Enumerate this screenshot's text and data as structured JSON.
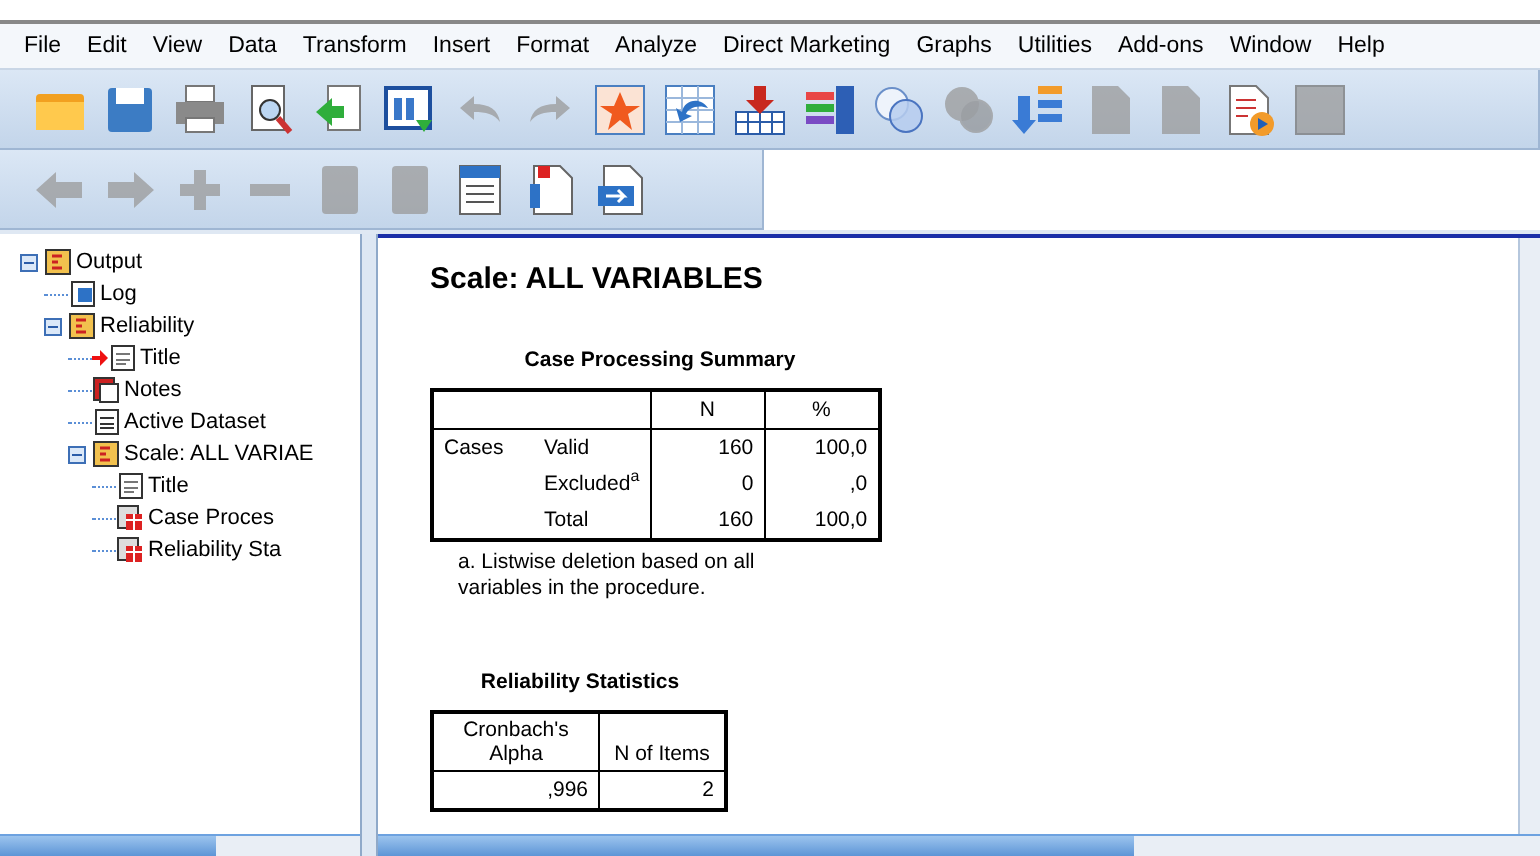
{
  "menu": [
    "File",
    "Edit",
    "View",
    "Data",
    "Transform",
    "Insert",
    "Format",
    "Analyze",
    "Direct Marketing",
    "Graphs",
    "Utilities",
    "Add-ons",
    "Window",
    "Help"
  ],
  "toolbar_main": [
    {
      "kind": "folder",
      "disabled": false
    },
    {
      "kind": "save",
      "disabled": false
    },
    {
      "kind": "print",
      "disabled": false
    },
    {
      "kind": "preview",
      "disabled": false
    },
    {
      "kind": "export",
      "disabled": false
    },
    {
      "kind": "dialog",
      "disabled": false
    },
    {
      "kind": "undo",
      "disabled": true
    },
    {
      "kind": "redo",
      "disabled": true
    },
    {
      "kind": "star",
      "disabled": false
    },
    {
      "kind": "gridarrow",
      "disabled": false
    },
    {
      "kind": "download",
      "disabled": false
    },
    {
      "kind": "bars",
      "disabled": false
    },
    {
      "kind": "circles",
      "disabled": false
    },
    {
      "kind": "circles",
      "disabled": true
    },
    {
      "kind": "tree",
      "disabled": false
    },
    {
      "kind": "doc",
      "disabled": true
    },
    {
      "kind": "doc",
      "disabled": true
    },
    {
      "kind": "script",
      "disabled": false
    },
    {
      "kind": "square",
      "disabled": true
    }
  ],
  "toolbar_outline": [
    {
      "kind": "back",
      "disabled": true
    },
    {
      "kind": "forward",
      "disabled": true
    },
    {
      "kind": "plus",
      "disabled": true
    },
    {
      "kind": "minus",
      "disabled": true
    },
    {
      "kind": "book",
      "disabled": true
    },
    {
      "kind": "book",
      "disabled": true
    },
    {
      "kind": "heading",
      "disabled": false
    },
    {
      "kind": "textdoc",
      "disabled": false
    },
    {
      "kind": "docarrow",
      "disabled": false
    }
  ],
  "outline": [
    {
      "label": "Output",
      "kind": "book",
      "expanded": true,
      "current": false,
      "children": [
        {
          "label": "Log",
          "kind": "log",
          "current": false
        },
        {
          "label": "Reliability",
          "kind": "book",
          "expanded": true,
          "current": false,
          "children": [
            {
              "label": "Title",
              "kind": "title",
              "current": true
            },
            {
              "label": "Notes",
              "kind": "notes",
              "current": false
            },
            {
              "label": "Active Dataset",
              "kind": "page",
              "current": false
            },
            {
              "label": "Scale: ALL VARIAE",
              "kind": "book",
              "expanded": true,
              "current": false,
              "children": [
                {
                  "label": "Title",
                  "kind": "title",
                  "current": false
                },
                {
                  "label": "Case Proces",
                  "kind": "table",
                  "current": false
                },
                {
                  "label": "Reliability Sta",
                  "kind": "table",
                  "current": false
                }
              ]
            }
          ]
        }
      ]
    }
  ],
  "output": {
    "heading": "Scale: ALL VARIABLES",
    "case_summary": {
      "title": "Case Processing Summary",
      "columns": [
        "",
        "",
        "N",
        "%"
      ],
      "rows": [
        [
          "Cases",
          "Valid",
          "160",
          "100,0"
        ],
        [
          "",
          "Excluded$^{a}$",
          "0",
          ",0"
        ],
        [
          "",
          "Total",
          "160",
          "100,0"
        ]
      ],
      "footnote": "a. Listwise deletion based on all variables in the procedure."
    },
    "reliability": {
      "title": "Reliability Statistics",
      "columns": [
        "Cronbach's Alpha",
        "N of Items"
      ],
      "rows": [
        [
          ",996",
          "2"
        ]
      ]
    }
  }
}
